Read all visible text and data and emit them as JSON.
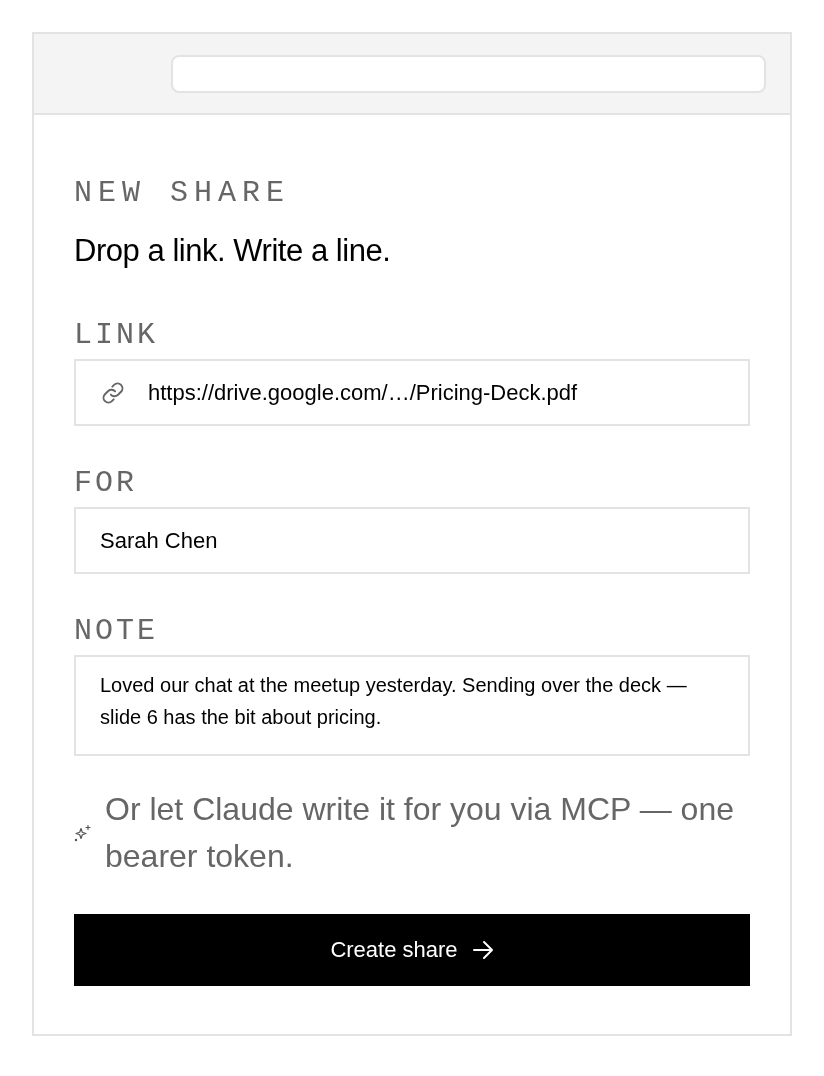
{
  "header": {
    "eyebrow": "NEW SHARE",
    "title": "Drop a link. Write a line."
  },
  "fields": [
    {
      "kind": "link",
      "label": "LINK",
      "value": "https://drive.google.com/…/Pricing-Deck.pdf"
    },
    {
      "kind": "text",
      "label": "FOR",
      "value": "Sarah Chen"
    },
    {
      "kind": "note",
      "label": "NOTE",
      "value": "Loved our chat at the meetup yesterday. Sending over the deck — slide 6 has the bit about pricing."
    }
  ],
  "mcp_hint": "Or let Claude write it for you via MCP — one bearer token.",
  "submit_button": {
    "label": "Create share"
  }
}
